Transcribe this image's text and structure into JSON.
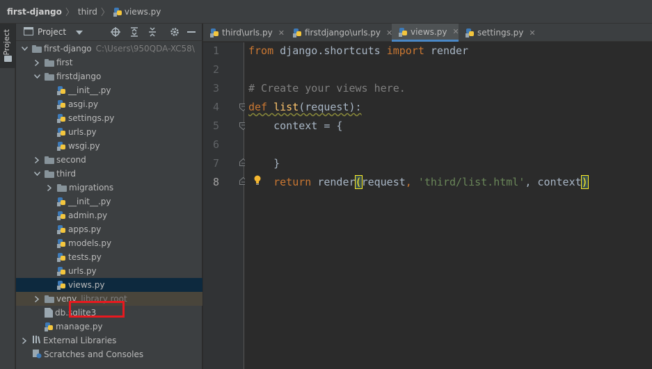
{
  "breadcrumb": {
    "project": "first-django",
    "folder": "third",
    "file": "views.py"
  },
  "stripe": {
    "label": "Project"
  },
  "project_panel": {
    "title": "Project",
    "tree": [
      {
        "label": "first-django",
        "meta": "C:\\Users\\950QDA-XC58\\",
        "type": "folder",
        "expanded": true
      },
      {
        "label": "first",
        "type": "folder",
        "expanded": false
      },
      {
        "label": "firstdjango",
        "type": "folder",
        "expanded": true
      },
      {
        "label": "__init__.py",
        "type": "py"
      },
      {
        "label": "asgi.py",
        "type": "py"
      },
      {
        "label": "settings.py",
        "type": "py"
      },
      {
        "label": "urls.py",
        "type": "py"
      },
      {
        "label": "wsgi.py",
        "type": "py"
      },
      {
        "label": "second",
        "type": "folder",
        "expanded": false
      },
      {
        "label": "third",
        "type": "folder",
        "expanded": true
      },
      {
        "label": "migrations",
        "type": "folder",
        "expanded": false
      },
      {
        "label": "__init__.py",
        "type": "py"
      },
      {
        "label": "admin.py",
        "type": "py"
      },
      {
        "label": "apps.py",
        "type": "py"
      },
      {
        "label": "models.py",
        "type": "py"
      },
      {
        "label": "tests.py",
        "type": "py"
      },
      {
        "label": "urls.py",
        "type": "py"
      },
      {
        "label": "views.py",
        "type": "py",
        "selected": true
      },
      {
        "label": "venv",
        "meta": "library root",
        "type": "folder",
        "expanded": false
      },
      {
        "label": "db.sqlite3",
        "type": "file"
      },
      {
        "label": "manage.py",
        "type": "py"
      },
      {
        "label": "External Libraries",
        "type": "lib",
        "expanded": false
      },
      {
        "label": "Scratches and Consoles",
        "type": "scratch"
      }
    ]
  },
  "tabs": [
    {
      "label": "third\\urls.py",
      "active": false
    },
    {
      "label": "firstdjango\\urls.py",
      "active": false
    },
    {
      "label": "views.py",
      "active": true
    },
    {
      "label": "settings.py",
      "active": false
    }
  ],
  "editor": {
    "line_numbers": [
      "1",
      "2",
      "3",
      "4",
      "5",
      "6",
      "7",
      "8"
    ],
    "current_line": 8,
    "lines": {
      "l1": {
        "a": "from",
        "b": " django.shortcuts ",
        "c": "import",
        "d": " render"
      },
      "l3": {
        "a": "# Create your views here."
      },
      "l4": {
        "a": "def",
        "b": " ",
        "c": "list",
        "d": "(request):"
      },
      "l5": {
        "a": "    context = {"
      },
      "l7": {
        "a": "    }"
      },
      "l8": {
        "a": "    ",
        "b": "return",
        "c": " render",
        "d": "(",
        "e": "request",
        "f": ", ",
        "g": "'third/list.html'",
        "h": ", context",
        "i": ")"
      }
    }
  },
  "colors": {
    "selection_outline": "#e8191f",
    "keyword": "#cc7832",
    "function": "#ffc66d",
    "string": "#6a8759",
    "comment": "#808080",
    "active_tab_underline": "#4a88c7"
  }
}
